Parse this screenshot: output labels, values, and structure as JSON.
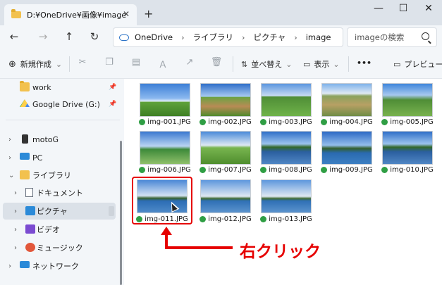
{
  "titlebar": {
    "tab_title": "D:¥OneDrive¥画像¥image",
    "tab_close": "✕",
    "new_tab": "+",
    "minimize": "—",
    "maximize": "☐",
    "close": "✕"
  },
  "nav": {
    "back": "←",
    "forward": "→",
    "up": "↑",
    "refresh": "↻",
    "breadcrumb": [
      "OneDrive",
      "ライブラリ",
      "ピクチャ",
      "image"
    ],
    "crumb_sep": "›",
    "search_placeholder": "imageの検索"
  },
  "commands": {
    "new_label": "新規作成",
    "new_icon": "⊕",
    "sort_label": "並べ替え",
    "sort_icon": "⇅",
    "view_label": "表示",
    "view_icon": "▭",
    "more_label": "•••",
    "preview_label": "プレビュー",
    "preview_icon": "▭",
    "dropdown": "⌄",
    "cut_icon": "✂",
    "copy_icon": "❐",
    "paste_icon": "▤",
    "rename_icon": "Ａ",
    "share_icon": "↗",
    "delete_icon": "🗑"
  },
  "sidebar": {
    "items": [
      {
        "label": "work",
        "icon": "folder-icon",
        "pinned": true
      },
      {
        "label": "Google Drive (G:)",
        "icon": "google-drive-icon",
        "pinned": true
      },
      {
        "label": "motoG",
        "icon": "phone-icon",
        "chevron": "›"
      },
      {
        "label": "PC",
        "icon": "pc-icon",
        "chevron": "›"
      },
      {
        "label": "ライブラリ",
        "icon": "library-icon",
        "chevron": "⌄"
      },
      {
        "label": "ドキュメント",
        "icon": "documents-icon",
        "chevron": "›"
      },
      {
        "label": "ピクチャ",
        "icon": "pictures-icon",
        "chevron": "›",
        "selected": true
      },
      {
        "label": "ビデオ",
        "icon": "videos-icon",
        "chevron": "›"
      },
      {
        "label": "ミュージック",
        "icon": "music-icon",
        "chevron": "›"
      },
      {
        "label": "ネットワーク",
        "icon": "network-icon",
        "chevron": "›"
      }
    ],
    "pin_glyph": "📌"
  },
  "files": [
    {
      "name": "img-001.JPG",
      "scene": "sky"
    },
    {
      "name": "img-002.JPG",
      "scene": "field"
    },
    {
      "name": "img-003.JPG",
      "scene": "rice"
    },
    {
      "name": "img-004.JPG",
      "scene": "valley"
    },
    {
      "name": "img-005.JPG",
      "scene": "hill"
    },
    {
      "name": "img-006.JPG",
      "scene": "road"
    },
    {
      "name": "img-007.JPG",
      "scene": "lawn"
    },
    {
      "name": "img-008.JPG",
      "scene": "lake"
    },
    {
      "name": "img-009.JPG",
      "scene": "bay"
    },
    {
      "name": "img-010.JPG",
      "scene": "lake"
    },
    {
      "name": "img-011.JPG",
      "scene": "sea",
      "highlighted": true
    },
    {
      "name": "img-012.JPG",
      "scene": "isle"
    },
    {
      "name": "img-013.JPG",
      "scene": "isle"
    }
  ],
  "annotation": {
    "text": "右クリック",
    "color": "#e60000"
  },
  "colors": {
    "accent": "#2b8ad8",
    "sync_ok": "#2f9e44",
    "annotation": "#e60000"
  }
}
